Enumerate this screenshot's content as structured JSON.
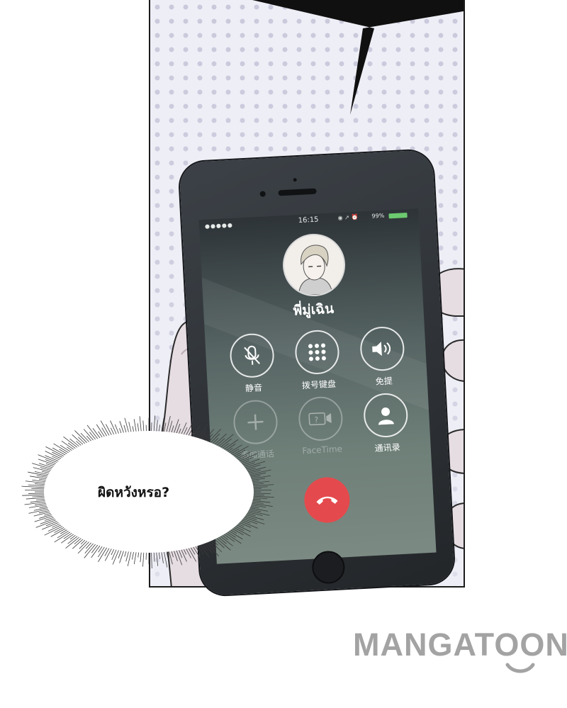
{
  "phone": {
    "status_bar": {
      "signal": "●●●●●",
      "time": "16:15",
      "icons": "◉ ↗ ⏰",
      "battery": "99%"
    },
    "caller_name": "พี่มู่เฉิน",
    "buttons": [
      {
        "label": "静音",
        "icon": "mic-off-icon"
      },
      {
        "label": "拨号键盘",
        "icon": "keypad-icon"
      },
      {
        "label": "免提",
        "icon": "speaker-icon"
      },
      {
        "label": "添加通话",
        "icon": "plus-icon"
      },
      {
        "label": "FaceTime",
        "icon": "facetime-icon"
      },
      {
        "label": "通讯录",
        "icon": "contact-icon"
      }
    ],
    "end_call_icon": "phone-hangup-icon"
  },
  "balloon": {
    "text": "ผิดหวังหรอ?"
  },
  "brand": {
    "name": "MANGATOON"
  },
  "colors": {
    "end_call": "#e44a4d",
    "battery": "#6cc96f",
    "brand": "#a3a3a3",
    "dots": "#c9c9dc"
  }
}
